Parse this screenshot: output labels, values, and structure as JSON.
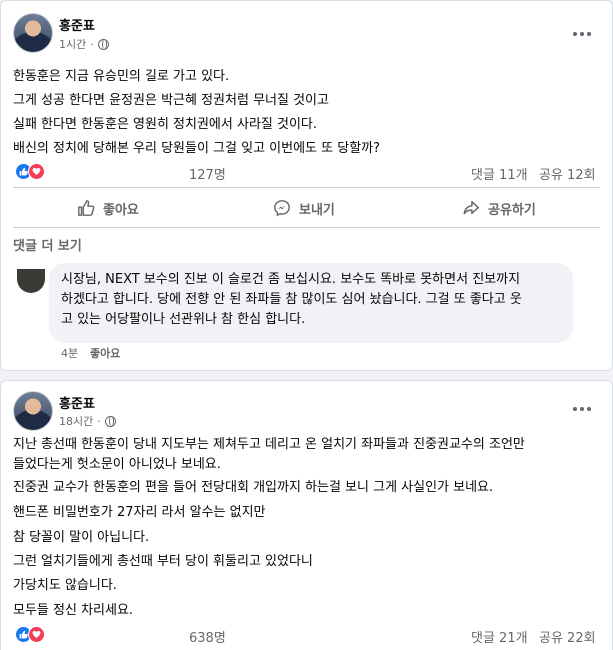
{
  "post1": {
    "author": "홍준표",
    "time": "1시간",
    "lines": [
      "한동훈은 지금 유승민의 길로 가고 있다.",
      "그게 성공 한다면 윤정권은 박근혜 정권처럼 무너질 것이고",
      "실패 한다면 한동훈은 영원히 정치권에서 사라질 것이다.",
      "배신의 정치에  당해본 우리 당원들이 그걸 잊고 이번에도 또 당할까?"
    ],
    "reactions_count": "127명",
    "comments_count": "댓글 11개",
    "shares_count": "공유 12회",
    "actions": {
      "like": "좋아요",
      "send": "보내기",
      "share": "공유하기"
    },
    "more_comments": "댓글 더 보기",
    "comment": {
      "lines": [
        "시장님, NEXT 보수의 진보 이 슬로건 좀 보십시요. 보수도 똑바로 못하면서 진보까지",
        "하겠다고 합니다. 당에 전향 안 된 좌파들 참 많이도 심어 놨습니다. 그걸 또 좋다고 웃",
        "고 있는 어당팔이나 선관위나 참 한심 합니다."
      ],
      "time": "4분",
      "like": "좋아요"
    }
  },
  "post2": {
    "author": "홍준표",
    "time": "18시간",
    "lines": [
      "지난 총선때 한동훈이 당내 지도부는 제쳐두고 데리고 온 얼치기 좌파들과 진중권교수의 조언만",
      "들었다는게 헛소문이 아니었나 보네요.",
      "진중권 교수가 한동훈의 편을 들어 전당대회 개입까지 하는걸 보니 그게 사실인가 보네요.",
      "핸드폰 비밀번호가 27자리 라서 알수는 없지만",
      "참 당꼴이 말이 아닙니다.",
      "그런 얼치기들에게 총선때 부터 당이 휘둘리고 있었다니",
      "가당치도 않습니다.",
      "모두들 정신 차리세요."
    ],
    "reactions_count": "638명",
    "comments_count": "댓글 21개",
    "shares_count": "공유 22회"
  },
  "colors": {
    "like_blue": "#1877f2",
    "love_red": "#f33e58",
    "muted": "#65676b"
  },
  "icons": [
    "globe-icon",
    "more-options-icon",
    "like-reaction-icon",
    "love-reaction-icon",
    "thumbs-up-icon",
    "messenger-icon",
    "share-arrow-icon"
  ]
}
